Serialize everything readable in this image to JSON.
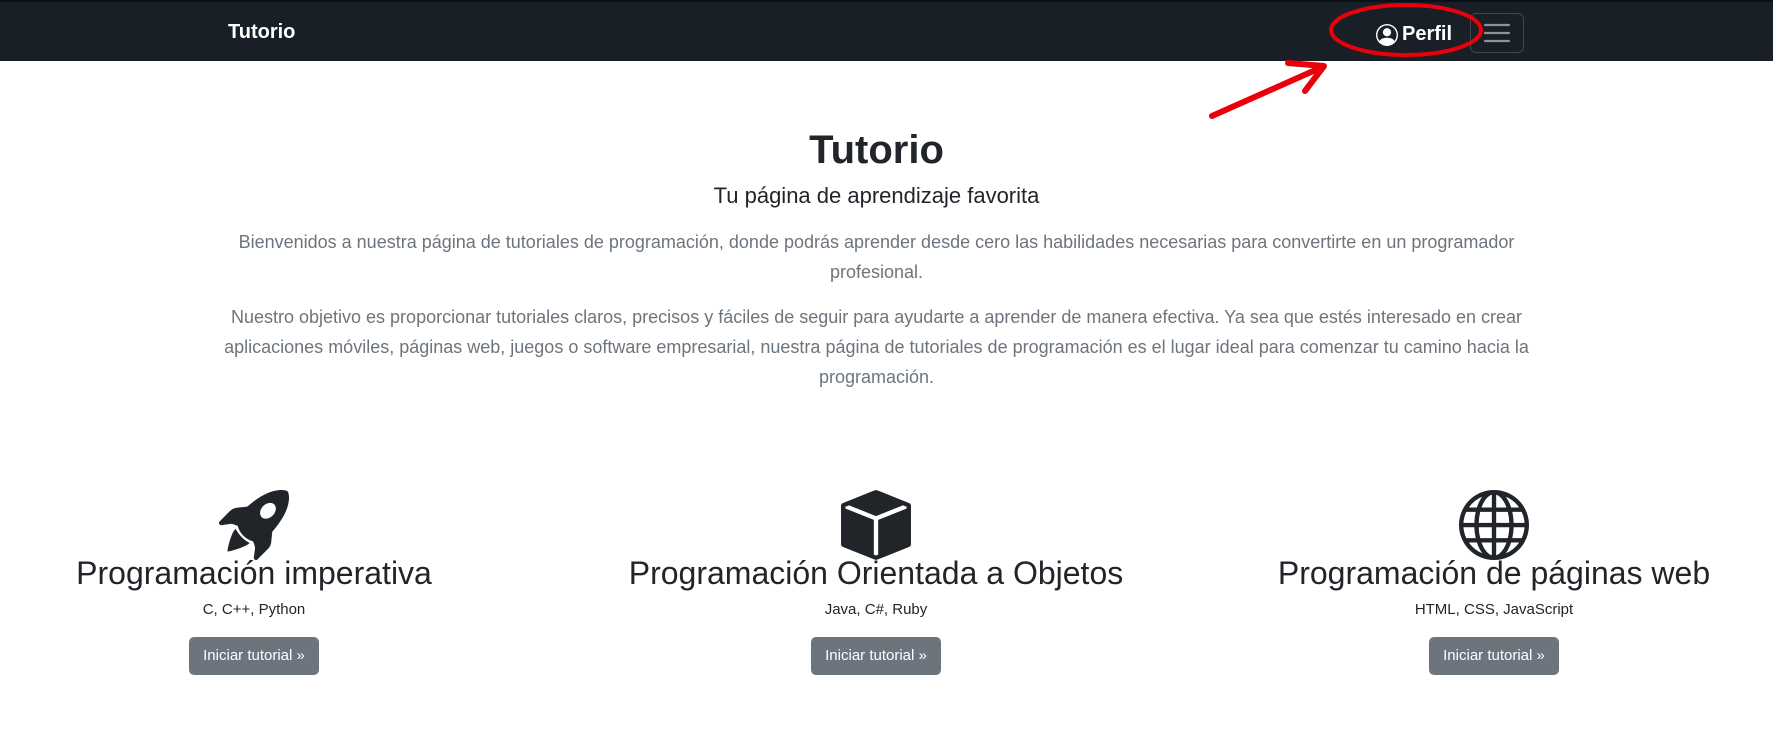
{
  "navbar": {
    "brand": "Tutorio",
    "profile_label": "Perfil",
    "profile_icon": "person-circle-icon",
    "toggler_icon": "hamburger-menu-icon",
    "background": "#191f26"
  },
  "annotation": {
    "color": "#e8000b"
  },
  "hero": {
    "title": "Tutorio",
    "subtitle": "Tu página de aprendizaje favorita",
    "paragraph_1": "Bienvenidos a nuestra página de tutoriales de programación, donde podrás aprender desde cero las habilidades necesarias para convertirte en un programador profesional.",
    "paragraph_2": "Nuestro objetivo es proporcionar tutoriales claros, precisos y fáciles de seguir para ayudarte a aprender de manera efectiva. Ya sea que estés interesado en crear aplicaciones móviles, páginas web, juegos o software empresarial, nuestra página de tutoriales de programación es el lugar ideal para comenzar tu camino hacia la programación."
  },
  "features": [
    {
      "icon": "rocket-icon",
      "title": "Programación imperativa",
      "languages": "C, C++, Python",
      "button": "Iniciar tutorial »"
    },
    {
      "icon": "box-icon",
      "title": "Programación Orientada a Objetos",
      "languages": "Java, C#, Ruby",
      "button": "Iniciar tutorial »"
    },
    {
      "icon": "globe-icon",
      "title": "Programación de páginas web",
      "languages": "HTML, CSS, JavaScript",
      "button": "Iniciar tutorial »"
    }
  ],
  "colors": {
    "button_bg": "#6c757d",
    "muted_text": "#6c757d",
    "dark_text": "#212529"
  }
}
